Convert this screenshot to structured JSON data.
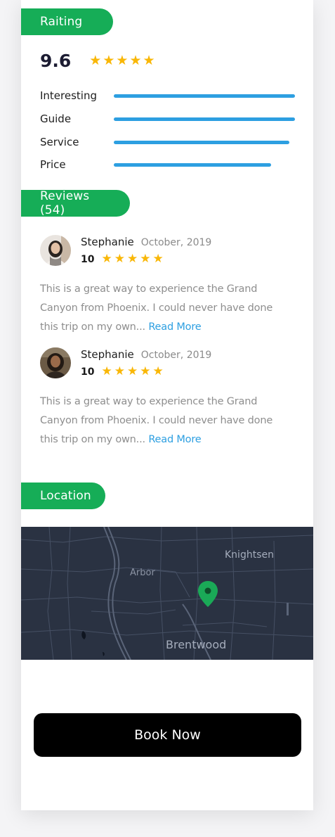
{
  "rating_section": {
    "header": "Raiting",
    "score": "9.6",
    "stars": 5,
    "metrics": [
      {
        "label": "Interesting",
        "value": 1.0
      },
      {
        "label": "Guide",
        "value": 1.0
      },
      {
        "label": "Service",
        "value": 0.97
      },
      {
        "label": "Price",
        "value": 0.87
      }
    ]
  },
  "reviews_section": {
    "header": "Reviews (54)",
    "items": [
      {
        "name": "Stephanie",
        "date": "October, 2019",
        "score": "10",
        "stars": 5,
        "text": "This is a great way to experience the Grand Canyon from Phoenix. I could never have done this trip on my own...",
        "read_more": "Read More"
      },
      {
        "name": "Stephanie",
        "date": "October, 2019",
        "score": "10",
        "stars": 5,
        "text": "This is a great way to experience the Grand Canyon from Phoenix. I could never have done this trip on my own...",
        "read_more": "Read More"
      }
    ]
  },
  "location_section": {
    "header": "Location",
    "map_labels": [
      "Knightsen",
      "Arbor",
      "Brentwood"
    ]
  },
  "book_button": "Book Now",
  "colors": {
    "accent_green": "#16ad57",
    "bar_blue": "#2d9fe1",
    "star_yellow": "#f9b707",
    "map_bg": "#2a3242",
    "pin_green": "#1aa957"
  },
  "icons": {
    "star": "star-icon",
    "map_pin": "map-pin-icon"
  }
}
